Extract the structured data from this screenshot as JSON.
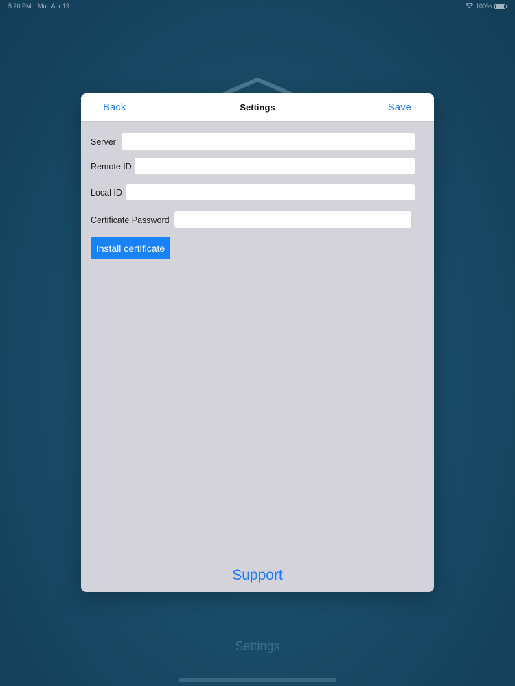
{
  "status_bar": {
    "time": "5:20 PM",
    "date": "Mon Apr 19",
    "battery": "100%"
  },
  "background": {
    "bottom_label": "Settings"
  },
  "modal": {
    "back_label": "Back",
    "title": "Settings",
    "save_label": "Save",
    "fields": {
      "server": {
        "label": "Server",
        "value": ""
      },
      "remote_id": {
        "label": "Remote ID",
        "value": ""
      },
      "local_id": {
        "label": "Local ID",
        "value": ""
      },
      "certificate_password": {
        "label": "Certificate Password",
        "value": ""
      }
    },
    "install_label": "Install certificate",
    "support_label": "Support"
  },
  "colors": {
    "accent": "#1a7cf4",
    "button": "#1a82f7",
    "modal_bg": "#d5d3da",
    "background": "#1a4d68"
  },
  "icons": [
    "wifi-icon",
    "battery-icon",
    "app-logo-icon"
  ]
}
